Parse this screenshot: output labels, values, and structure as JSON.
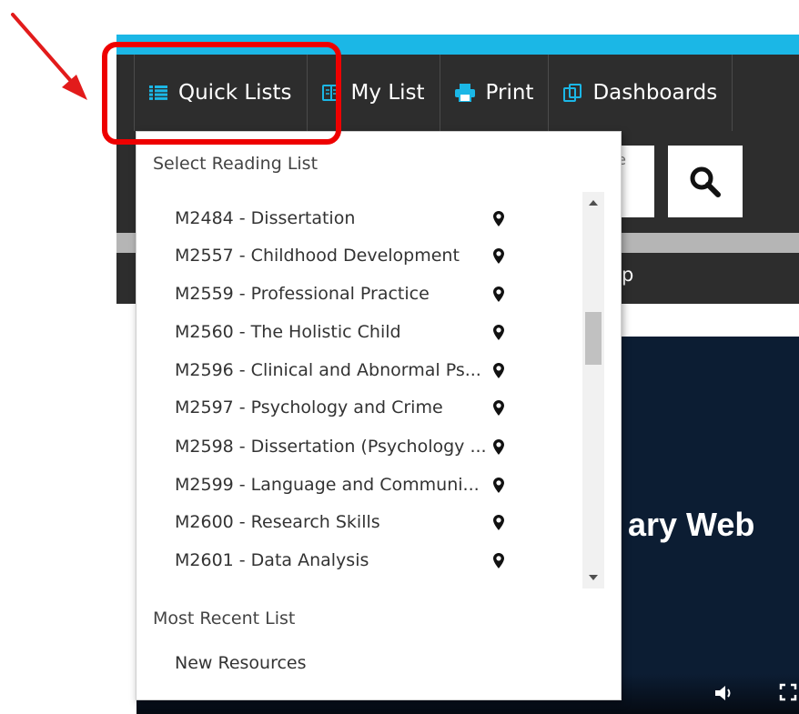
{
  "toolbar": {
    "buttons": [
      {
        "label": "Quick Lists",
        "icon": "list-icon"
      },
      {
        "label": "My List",
        "icon": "book-icon"
      },
      {
        "label": "Print",
        "icon": "printer-icon"
      },
      {
        "label": "Dashboards",
        "icon": "copy-icon"
      }
    ]
  },
  "search": {
    "placeholder_fragment": "ete",
    "icon": "search-icon"
  },
  "menu_bar": {
    "text_fragment": "p"
  },
  "video": {
    "title_fragment": "ary Web",
    "controls": [
      "volume-icon",
      "fullscreen-icon"
    ]
  },
  "dropdown": {
    "header": "Select Reading List",
    "items": [
      {
        "label": "M2484 - Dissertation",
        "icon": "map-pin-icon"
      },
      {
        "label": "M2557 - Childhood Development",
        "icon": "map-pin-icon"
      },
      {
        "label": "M2559 - Professional Practice",
        "icon": "map-pin-icon"
      },
      {
        "label": "M2560 - The Holistic Child",
        "icon": "map-pin-icon"
      },
      {
        "label": "M2596 - Clinical and Abnormal Ps...",
        "icon": "map-pin-icon"
      },
      {
        "label": "M2597 - Psychology and Crime",
        "icon": "map-pin-icon"
      },
      {
        "label": "M2598 - Dissertation (Psychology ...",
        "icon": "map-pin-icon"
      },
      {
        "label": "M2599 - Language and Communi...",
        "icon": "map-pin-icon"
      },
      {
        "label": "M2600 - Research Skills",
        "icon": "map-pin-icon"
      },
      {
        "label": "M2601 - Data Analysis",
        "icon": "map-pin-icon"
      }
    ],
    "recent_header": "Most Recent List",
    "recent_items": [
      {
        "label": "New Resources"
      }
    ]
  },
  "annotation": {
    "highlight_color": "#ee0000",
    "arrow_color": "#e21b1b"
  },
  "colors": {
    "accent": "#1bb7e6",
    "toolbar_bg": "#2d2d2d",
    "video_bg": "#0c1d33"
  }
}
